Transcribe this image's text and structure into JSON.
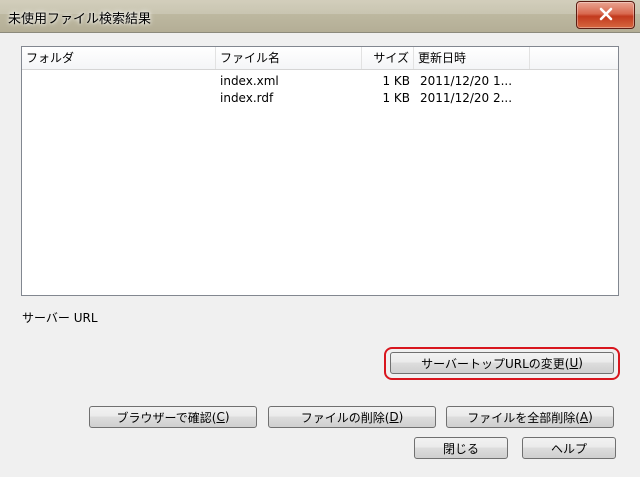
{
  "window": {
    "title": "未使用ファイル検索結果"
  },
  "list": {
    "columns": [
      "フォルダ",
      "ファイル名",
      "サイズ",
      "更新日時"
    ],
    "rows": [
      {
        "folder": "",
        "file": "index.xml",
        "size": "1 KB",
        "modified": "2011/12/20 1..."
      },
      {
        "folder": "",
        "file": "index.rdf",
        "size": "1 KB",
        "modified": "2011/12/20 2..."
      }
    ]
  },
  "server": {
    "label": "サーバー URL"
  },
  "buttons": {
    "change_url": {
      "text": "サーバートップURLの変更(",
      "key": "U",
      "end": ")"
    },
    "browser_confirm": {
      "text": "ブラウザーで確認(",
      "key": "C",
      "end": ")"
    },
    "delete_file": {
      "text": "ファイルの削除(",
      "key": "D",
      "end": ")"
    },
    "delete_all": {
      "text": "ファイルを全部削除(",
      "key": "A",
      "end": ")"
    },
    "close": "閉じる",
    "help": "ヘルプ"
  },
  "colors": {
    "highlight": "#d8161e",
    "close_button": "#c23a1e"
  },
  "icons": {
    "close": "close-icon"
  }
}
